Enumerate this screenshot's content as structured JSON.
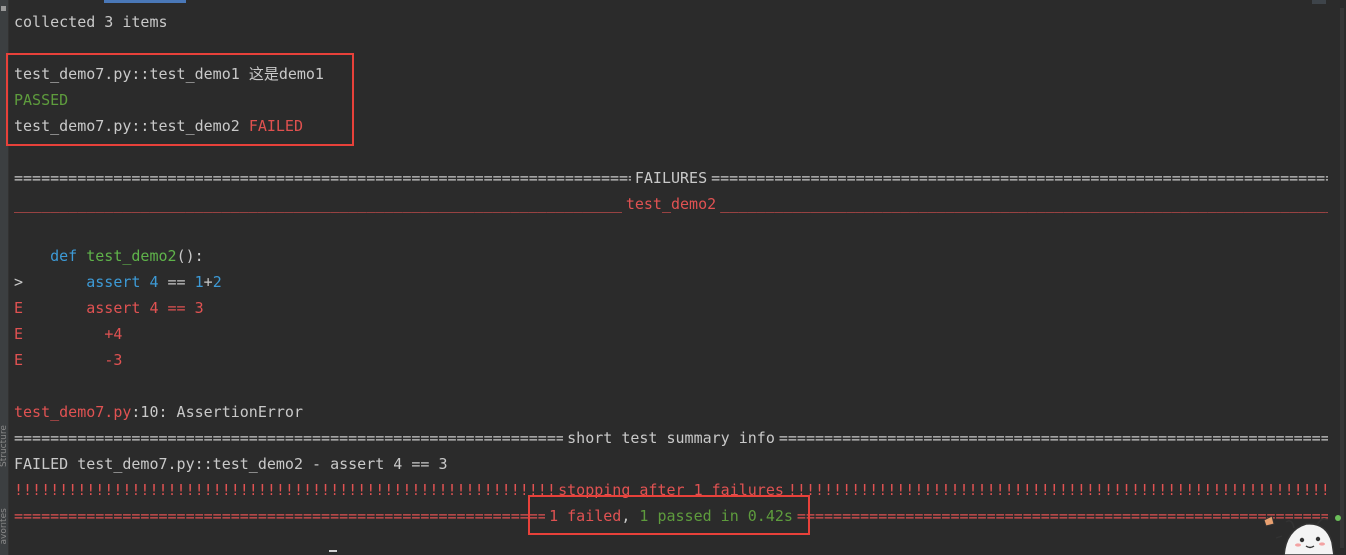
{
  "side": {
    "structure": "Structure",
    "favorites": "avorites"
  },
  "console": {
    "collected": "collected 3 items",
    "test1_prefix": "test_demo7.py::test_demo1 ",
    "test1_suffix": "这是demo1",
    "passed": "PASSED",
    "test2_prefix": "test_demo7.py::test_demo2 ",
    "test2_status": "FAILED",
    "failures_title": "FAILURES",
    "test_name_title": "test_demo2",
    "def_kw": "def",
    "def_name": "test_demo2",
    "def_paren": "():",
    "arrow": ">",
    "assert_kw": "assert",
    "assert_num": "4",
    "assert_eq": " == ",
    "assert_n1": "1",
    "assert_plus": "+",
    "assert_n2": "2",
    "e_marker": "E",
    "e_line1": "assert 4 == 3",
    "e_line2": "+4",
    "e_line3": "-3",
    "error_file": "test_demo7.py",
    "error_rest": ":10: AssertionError",
    "summary_title": "short test summary info",
    "summary_line": "FAILED test_demo7.py::test_demo2 - assert 4 == 3",
    "stopping_title": "stopping after 1 failures",
    "result_failed": "1 failed",
    "result_sep": ", ",
    "result_passed": "1 passed",
    "result_time": " in 0.42s"
  },
  "colors": {
    "background": "#2b2b2b",
    "passed": "#5e9c3d",
    "failed": "#e0514f",
    "keyword": "#3d9ad6",
    "highlight_box": "#e8413a"
  }
}
